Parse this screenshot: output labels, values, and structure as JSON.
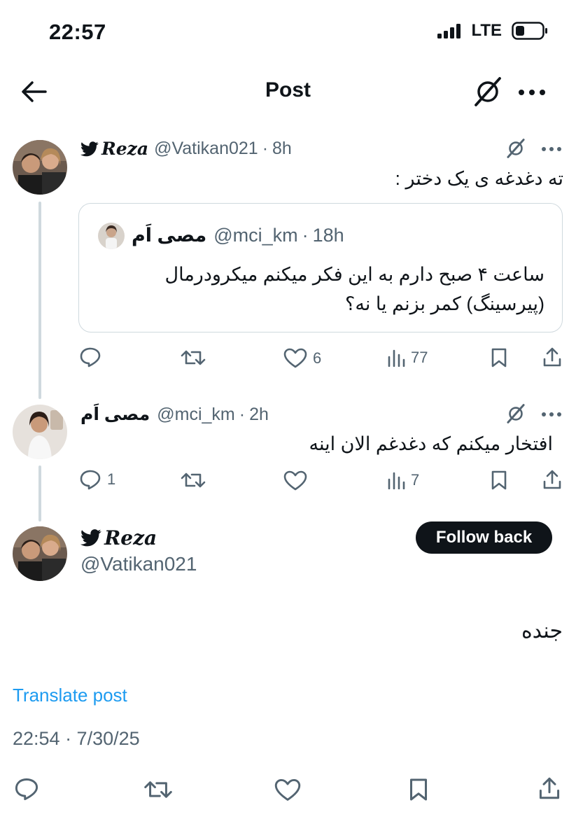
{
  "status_bar": {
    "time": "22:57",
    "network": "LTE"
  },
  "header": {
    "title": "Post"
  },
  "tweet1": {
    "name": "Reza",
    "handle": "@Vatikan021",
    "sep": "·",
    "time": "8h",
    "text": "ته دغدغه ی یک دختر :",
    "quote": {
      "name": "مصی اَم",
      "handle": "@mci_km",
      "sep": "·",
      "time": "18h",
      "line1": "ساعت ۴ صبح دارم به این فکر میکنم میکرودرمال",
      "line2": "(پیرسینگ) کمر بزنم یا نه؟"
    },
    "actions": {
      "likes": "6",
      "views": "77"
    }
  },
  "tweet2": {
    "name": "مصی اَم",
    "handle": "@mci_km",
    "sep": "·",
    "time": "2h",
    "text": "افتخار میکنم که دغدغم الان اینه",
    "actions": {
      "replies": "1",
      "views": "7"
    }
  },
  "main_post": {
    "name": "Reza",
    "handle": "@Vatikan021",
    "follow_label": "Follow back",
    "text": "جنده",
    "translate": "Translate post",
    "timestamp": "22:54 · 7/30/25"
  },
  "colors": {
    "accent": "#1d9bf0",
    "text": "#0f1419",
    "secondary": "#536471",
    "border": "#cfd9de"
  }
}
